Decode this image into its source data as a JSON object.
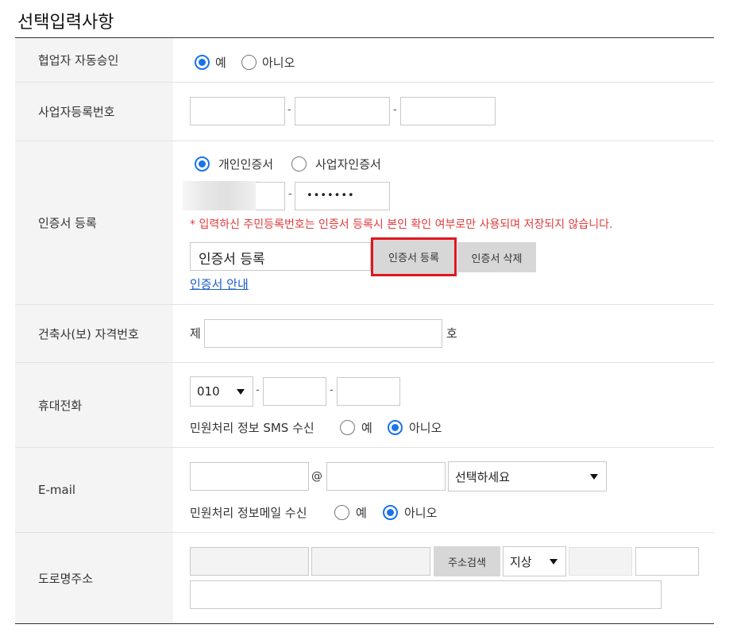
{
  "section_title": "선택입력사항",
  "rows": {
    "auto_approve": {
      "label": "협업자 자동승인",
      "opt_yes": "예",
      "opt_no": "아니오"
    },
    "business_no": {
      "label": "사업자등록번호",
      "sep": "-"
    },
    "cert": {
      "label": "인증서 등록",
      "opt_personal": "개인인증서",
      "opt_business": "사업자인증서",
      "sep": "-",
      "masked_value": "•••••••",
      "warning": "* 입력하신 주민등록번호는 인증서 등록시 본인 확인 여부로만 사용되며 저장되지 않습니다.",
      "cert_field_value": "인증서 등록",
      "register_button": "인증서 등록",
      "delete_button": "인증서 삭제",
      "guide_link": "인증서 안내"
    },
    "architect_no": {
      "label": "건축사(보) 자격번호",
      "prefix": "제",
      "suffix": "호"
    },
    "mobile": {
      "label": "휴대전화",
      "area_code": "010",
      "sep": "-",
      "sms_label": "민원처리 정보 SMS 수신",
      "opt_yes": "예",
      "opt_no": "아니오"
    },
    "email": {
      "label": "E-mail",
      "at": "@",
      "domain_select": "선택하세요",
      "mail_label": "민원처리 정보메일 수신",
      "opt_yes": "예",
      "opt_no": "아니오"
    },
    "road_address": {
      "label": "도로명주소",
      "search_button": "주소검색",
      "floor_select": "지상"
    }
  },
  "highlight_color": "#e0161e",
  "accent_color": "#1a73e8",
  "warning_color": "#e03c3c"
}
